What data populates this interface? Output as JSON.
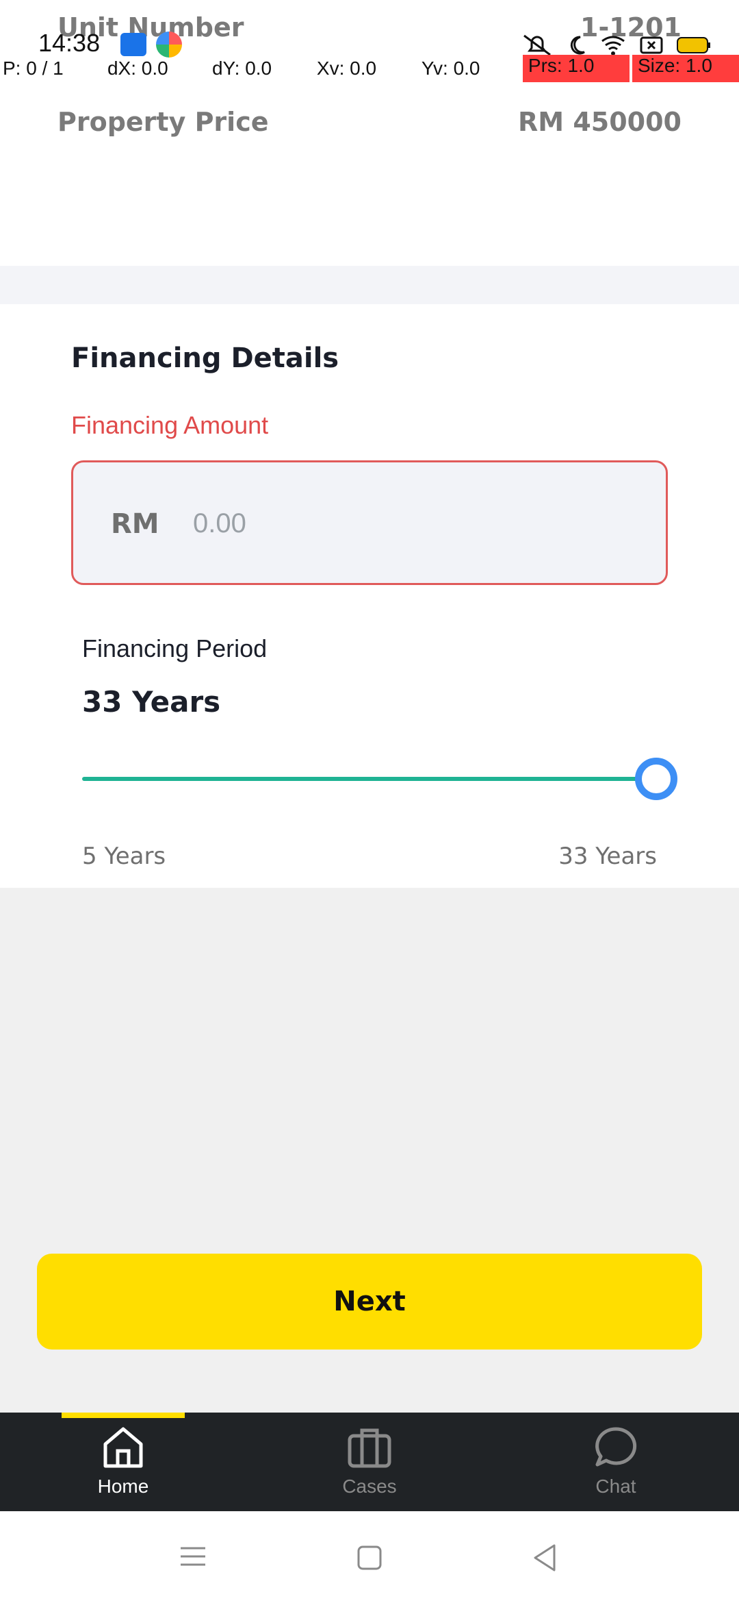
{
  "status_bar": {
    "time": "14:38"
  },
  "debug_overlay": {
    "p": "P: 0 / 1",
    "dx": "dX: 0.0",
    "dy": "dY: 0.0",
    "xv": "Xv: 0.0",
    "yv": "Yv: 0.0",
    "prs": "Prs: 1.0",
    "size": "Size: 1.0"
  },
  "property": {
    "unit_label": "Unit Number",
    "unit_value": "1-1201",
    "price_label": "Property Price",
    "price_value": "RM 450000"
  },
  "financing": {
    "title": "Financing Details",
    "amount_label": "Financing Amount",
    "currency_prefix": "RM",
    "amount_placeholder": "0.00",
    "period_label": "Financing Period",
    "period_value": "33 Years",
    "slider": {
      "min": 5,
      "max": 33,
      "value": 33
    },
    "min_label": "5 Years",
    "max_label": "33 Years"
  },
  "actions": {
    "next_label": "Next"
  },
  "bottom_nav": {
    "items": [
      {
        "label": "Home",
        "icon": "home-icon",
        "active": true
      },
      {
        "label": "Cases",
        "icon": "briefcase-icon",
        "active": false
      },
      {
        "label": "Chat",
        "icon": "chat-icon",
        "active": false
      }
    ]
  },
  "colors": {
    "accent_yellow": "#ffde00",
    "error_red": "#e04a4a",
    "slider_green": "#1fb394",
    "thumb_blue": "#3d8ff5",
    "nav_bg": "#202326"
  }
}
